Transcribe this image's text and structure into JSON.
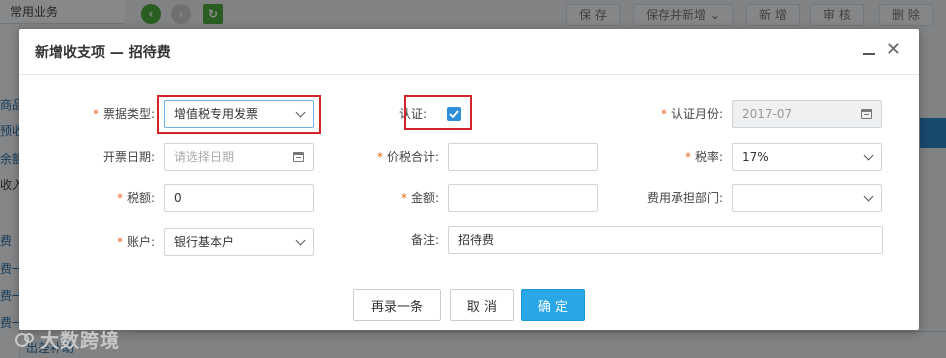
{
  "background": {
    "tab_label": "常用业务",
    "sidebar_items": [
      "商品",
      "预收",
      "余额",
      "收入",
      "费",
      "费一",
      "费一",
      "费一",
      "出差补助"
    ],
    "toolbar": [
      "保 存",
      "保存并新增",
      "新 增",
      "审 核",
      "删 除"
    ],
    "toolbar_dropdown_icon": "chevron-down-icon",
    "nav_icons": [
      "back-arrow-icon",
      "forward-arrow-icon",
      "refresh-icon"
    ],
    "watermark": "大数跨境"
  },
  "dialog": {
    "title": "新增收支项 — 招待费",
    "minimize_icon": "minimize-icon",
    "close_glyph": "✕",
    "fields": {
      "ticket_type": {
        "label": "票据类型:",
        "value": "增值税专用发票",
        "required": true
      },
      "certified": {
        "label": "认证:",
        "checked": true
      },
      "cert_month": {
        "label": "认证月份:",
        "value": "2017-07",
        "required": true
      },
      "invoice_date": {
        "label": "开票日期:",
        "placeholder": "请选择日期"
      },
      "total_with_tax": {
        "label": "价税合计:",
        "value": "",
        "required": true
      },
      "tax_rate": {
        "label": "税率:",
        "value": "17%",
        "required": true
      },
      "tax_amount": {
        "label": "税额:",
        "value": "0",
        "required": true
      },
      "amount": {
        "label": "金额:",
        "value": "",
        "required": true
      },
      "cost_department": {
        "label": "费用承担部门:",
        "value": ""
      },
      "account": {
        "label": "账户:",
        "value": "银行基本户",
        "required": true
      },
      "remark": {
        "label": "备注:",
        "value": "招待费"
      }
    },
    "buttons": {
      "save_add": "再录一条",
      "cancel": "取 消",
      "confirm": "确 定"
    }
  },
  "colors": {
    "required_star": "#e86a1c",
    "primary": "#29a6e6",
    "highlight_box": "#d2232a",
    "checkbox": "#2f8fd8"
  }
}
